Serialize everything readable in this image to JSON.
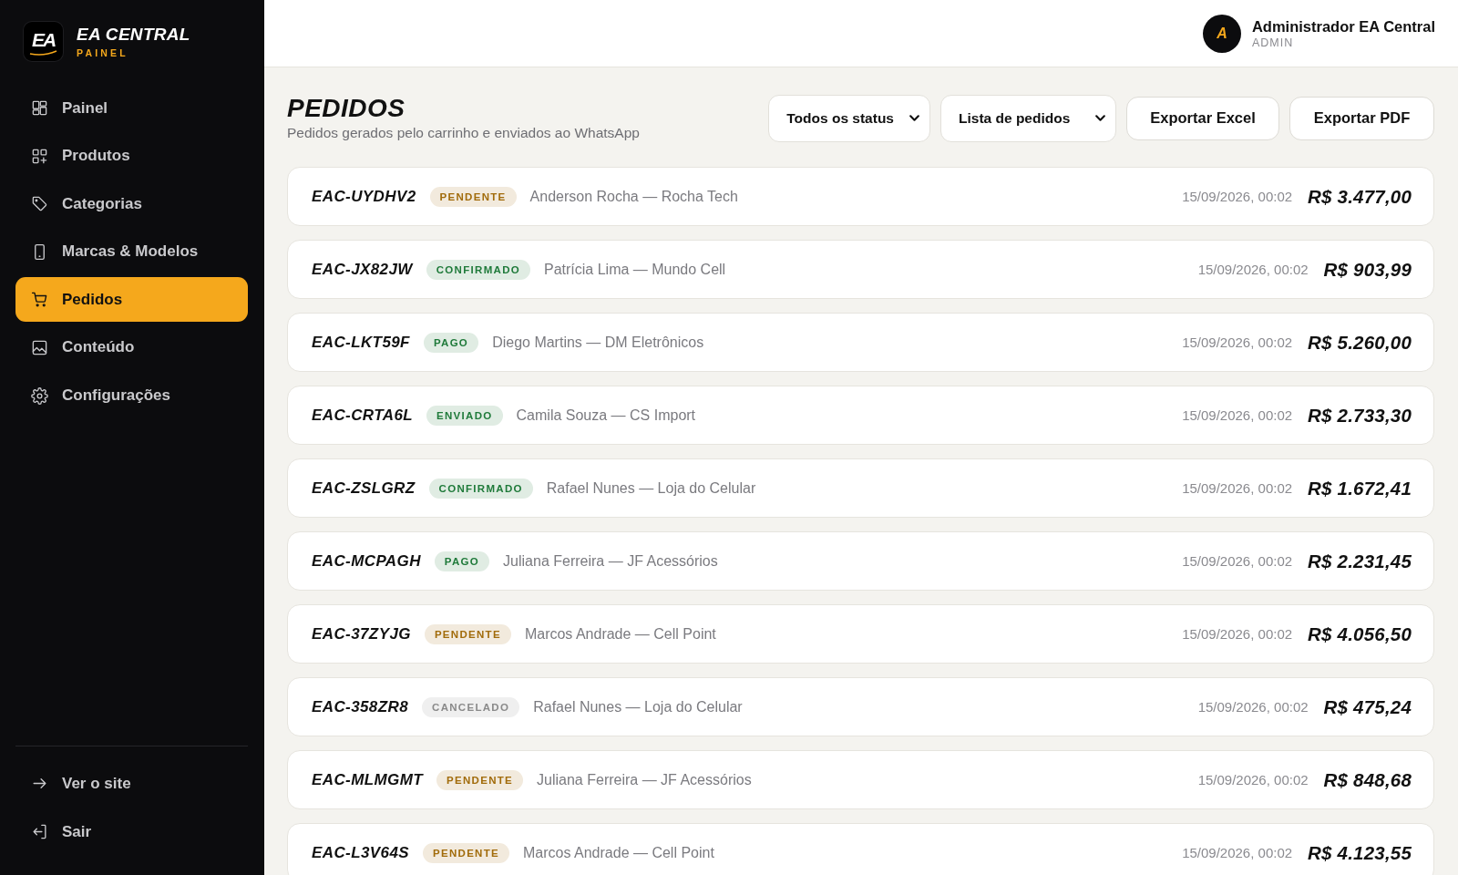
{
  "sidebar": {
    "brand": {
      "logo_mark": "EA",
      "title": "EA CENTRAL",
      "subtitle": "PAINEL"
    },
    "items": [
      {
        "label": "Painel",
        "selected": false
      },
      {
        "label": "Produtos",
        "selected": false
      },
      {
        "label": "Categorias",
        "selected": false
      },
      {
        "label": "Marcas & Modelos",
        "selected": false
      },
      {
        "label": "Pedidos",
        "selected": true
      },
      {
        "label": "Conteúdo",
        "selected": false
      },
      {
        "label": "Configurações",
        "selected": false
      }
    ],
    "footer_items": [
      "Ver o site",
      "Sair"
    ]
  },
  "header": {
    "user": {
      "initial": "A",
      "name": "Administrador EA Central",
      "role": "ADMIN"
    }
  },
  "page": {
    "title": "PEDIDOS",
    "subtitle": "Pedidos gerados pelo carrinho e enviados ao WhatsApp"
  },
  "filters": [
    {
      "value": "Todos os status"
    },
    {
      "value": "Lista de pedidos"
    }
  ],
  "buttons": [
    "Exportar Excel",
    "Exportar PDF"
  ],
  "orders": [
    {
      "id": "EAC-UYDHV2",
      "status": {
        "label": "PENDENTE",
        "color": "#a16b0a"
      },
      "customer": "Anderson Rocha — Rocha Tech",
      "date": "15/09/2026, 00:02",
      "total": "R$ 3.477,00"
    },
    {
      "id": "EAC-JX82JW",
      "status": {
        "label": "CONFIRMADO",
        "color": "#1f7a3a"
      },
      "customer": "Patrícia Lima — Mundo Cell",
      "date": "15/09/2026, 00:02",
      "total": "R$ 903,99"
    },
    {
      "id": "EAC-LKT59F",
      "status": {
        "label": "PAGO",
        "color": "#1f7a3a"
      },
      "customer": "Diego Martins — DM Eletrônicos",
      "date": "15/09/2026, 00:02",
      "total": "R$ 5.260,00"
    },
    {
      "id": "EAC-CRTA6L",
      "status": {
        "label": "ENVIADO",
        "color": "#1f7a3a"
      },
      "customer": "Camila Souza — CS Import",
      "date": "15/09/2026, 00:02",
      "total": "R$ 2.733,30"
    },
    {
      "id": "EAC-ZSLGRZ",
      "status": {
        "label": "CONFIRMADO",
        "color": "#1f7a3a"
      },
      "customer": "Rafael Nunes — Loja do Celular",
      "date": "15/09/2026, 00:02",
      "total": "R$ 1.672,41"
    },
    {
      "id": "EAC-MCPAGH",
      "status": {
        "label": "PAGO",
        "color": "#1f7a3a"
      },
      "customer": "Juliana Ferreira — JF Acessórios",
      "date": "15/09/2026, 00:02",
      "total": "R$ 2.231,45"
    },
    {
      "id": "EAC-37ZYJG",
      "status": {
        "label": "PENDENTE",
        "color": "#a16b0a"
      },
      "customer": "Marcos Andrade — Cell Point",
      "date": "15/09/2026, 00:02",
      "total": "R$ 4.056,50"
    },
    {
      "id": "EAC-358ZR8",
      "status": {
        "label": "CANCELADO",
        "color": "#8a8a8a"
      },
      "customer": "Rafael Nunes — Loja do Celular",
      "date": "15/09/2026, 00:02",
      "total": "R$ 475,24"
    },
    {
      "id": "EAC-MLMGMT",
      "status": {
        "label": "PENDENTE",
        "color": "#a16b0a"
      },
      "customer": "Juliana Ferreira — JF Acessórios",
      "date": "15/09/2026, 00:02",
      "total": "R$ 848,68"
    },
    {
      "id": "EAC-L3V64S",
      "status": {
        "label": "PENDENTE",
        "color": "#a16b0a"
      },
      "customer": "Marcos Andrade — Cell Point",
      "date": "15/09/2026, 00:02",
      "total": "R$ 4.123,55"
    }
  ]
}
